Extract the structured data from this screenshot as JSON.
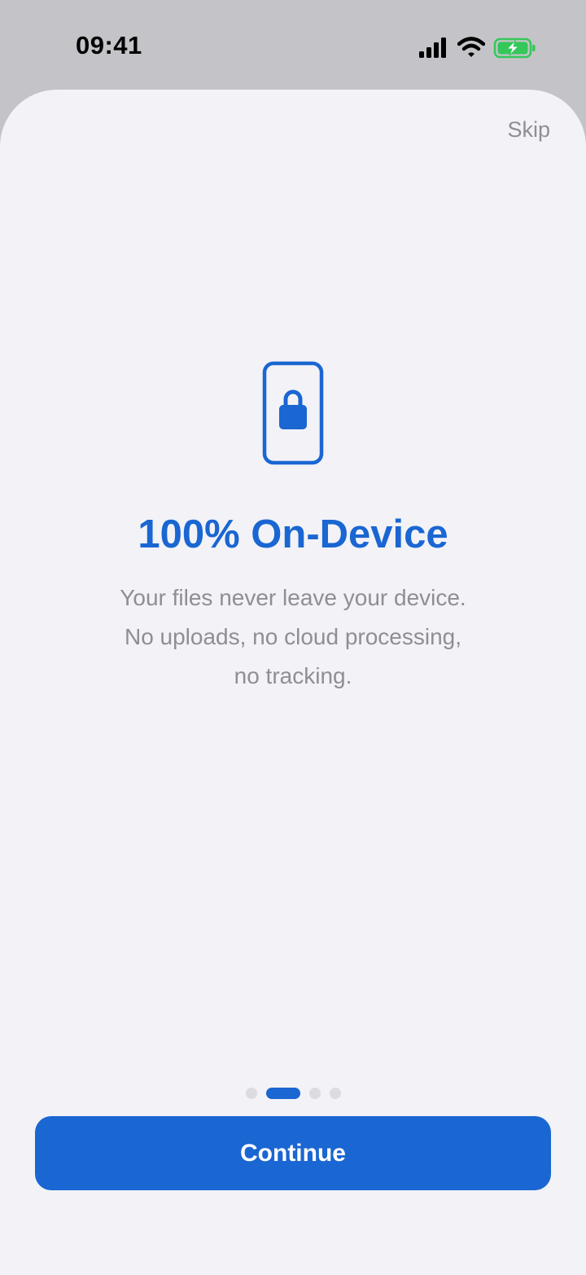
{
  "status_bar": {
    "time": "09:41",
    "icons": [
      "cellular-signal-icon",
      "wifi-icon",
      "battery-charging-icon"
    ],
    "battery_color": "#34c759"
  },
  "onboarding": {
    "skip_label": "Skip",
    "icon": "phone-lock-icon",
    "title": "100% On-Device",
    "description_lines": [
      "Your files never leave your device.",
      "No uploads, no cloud processing,",
      "no tracking."
    ],
    "page_count": 4,
    "current_page": 2,
    "continue_label": "Continue"
  },
  "colors": {
    "accent": "#1a66d2",
    "background": "#f2f2f7",
    "secondary_text": "#8e8e93",
    "status_area": "#c4c4c8"
  }
}
